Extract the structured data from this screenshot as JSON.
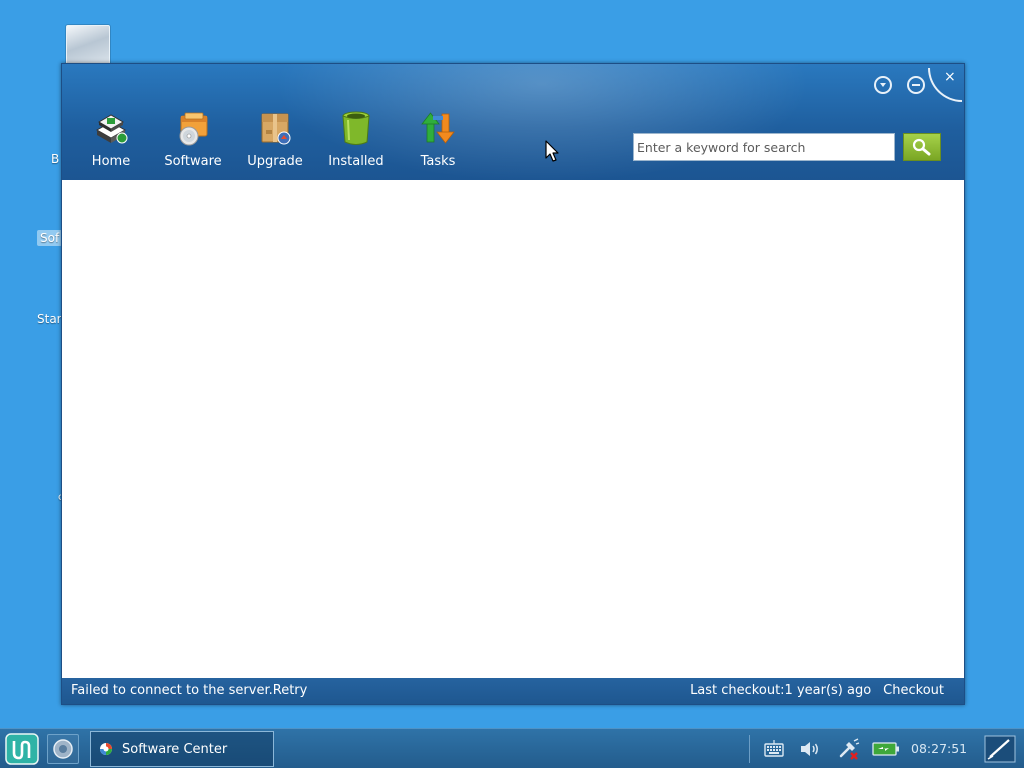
{
  "desktop": {
    "labels": [
      "B",
      "Sof",
      "Star",
      "c"
    ]
  },
  "window": {
    "nav": {
      "home": "Home",
      "software": "Software",
      "upgrade": "Upgrade",
      "installed": "Installed",
      "tasks": "Tasks"
    },
    "search": {
      "placeholder": "Enter a keyword for search"
    },
    "controls": {
      "close_glyph": "×"
    },
    "status": {
      "message": "Failed to connect to the server.",
      "retry": "Retry",
      "last_checkout": "Last checkout:1 year(s) ago",
      "checkout": "Checkout"
    }
  },
  "taskbar": {
    "task_label": "Software Center",
    "clock": "08:27:51"
  },
  "colors": {
    "desktop": "#3a9ee6",
    "header": "#1f5f9f",
    "search_button": "#8ab832"
  },
  "icons": {
    "home": "home-stack-icon",
    "software": "software-box-icon",
    "upgrade": "upgrade-package-icon",
    "installed": "installed-bin-icon",
    "tasks": "tasks-arrows-icon"
  }
}
